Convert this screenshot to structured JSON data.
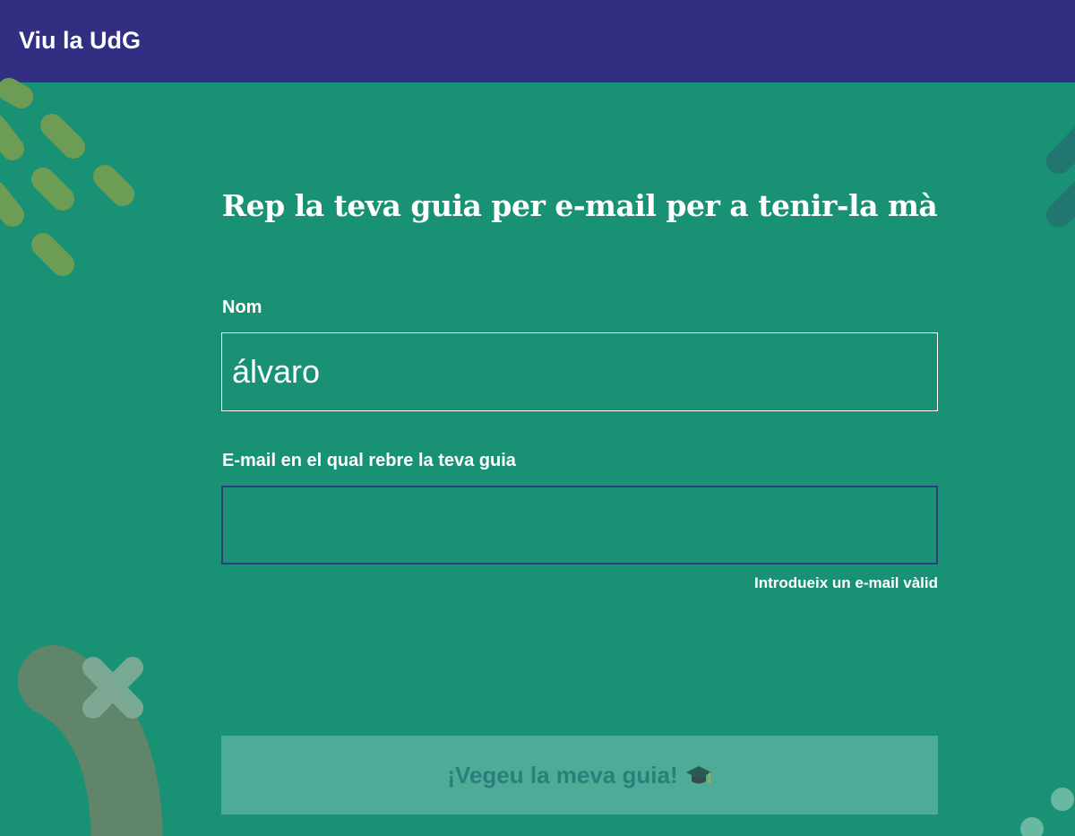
{
  "header": {
    "brand": "Viu la UdG"
  },
  "form": {
    "title": "Rep la teva guia per e-mail per a tenir-la mà",
    "name_label": "Nom",
    "name_value": "álvaro",
    "email_label": "E-mail en el qual rebre la teva guia",
    "email_value": "",
    "email_error": "Introdueix un e-mail vàlid",
    "submit_label": "¡Vegeu la meva guia!",
    "submit_icon": "graduation-cap-icon"
  },
  "colors": {
    "header_bg": "#322e82",
    "page_bg": "#199174",
    "button_bg": "#4eab97",
    "button_text": "#2a7f7a",
    "invalid_border": "#2c3e7c"
  }
}
